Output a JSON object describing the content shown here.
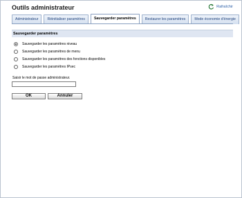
{
  "header": {
    "title": "Outils administrateur",
    "refresh_label": "Rafraîchir"
  },
  "tabs": [
    {
      "label": "Administrateur",
      "active": false
    },
    {
      "label": "Réinitialiser paramètres",
      "active": false
    },
    {
      "label": "Sauvegarder paramètres",
      "active": true
    },
    {
      "label": "Restaurer les paramètres",
      "active": false
    },
    {
      "label": "Mode économie d'énergie",
      "active": false
    }
  ],
  "panel": {
    "heading": "Sauvegarder paramètres",
    "options": [
      {
        "label": "Sauvegarder les paramètres niveau",
        "selected": true
      },
      {
        "label": "Sauvegarder les paramètres de menu",
        "selected": false
      },
      {
        "label": "Sauvegarder les paramètres des fonctions disponibles",
        "selected": false
      },
      {
        "label": "Sauvegarder les paramètres IPsec",
        "selected": false
      }
    ]
  },
  "password": {
    "label": "Saisir le mot de passe administrateur.",
    "value": ""
  },
  "buttons": {
    "ok_label": "OK",
    "cancel_label": "Annuler"
  },
  "colors": {
    "tab_bg": "#d4e0f0",
    "panel_head_bg": "#dfe6f2",
    "link": "#2b5fa8"
  },
  "icons": {
    "refresh": "refresh-icon"
  }
}
